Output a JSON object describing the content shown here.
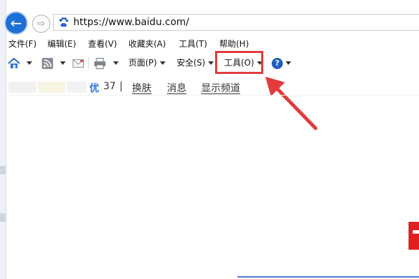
{
  "address_bar": {
    "url": "https://www.baidu.com/"
  },
  "menu_bar": [
    "文件(F)",
    "编辑(E)",
    "查看(V)",
    "收藏夹(A)",
    "工具(T)",
    "帮助(H)"
  ],
  "command_bar": {
    "page_label": "页面(P)",
    "safety_label": "安全(S)",
    "tools_label": "工具(O)"
  },
  "links_row": {
    "you_label": "优",
    "count": "37",
    "separator": "|",
    "links": [
      "换肤",
      "消息",
      "显示频道"
    ]
  },
  "colors": {
    "accent": "#1e6fd6",
    "highlight": "#e23b3b"
  }
}
